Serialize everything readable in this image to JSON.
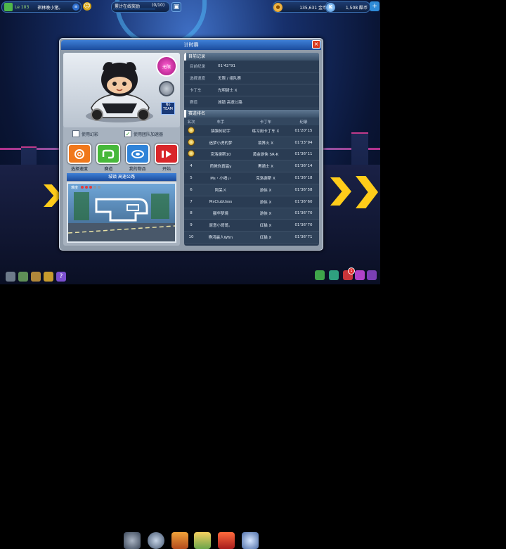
{
  "topbar": {
    "level": "Le 103",
    "player_name": "祺林晚小猪。",
    "online_label": "累计在线奖励",
    "online_progress": "(0/10)",
    "online_fraction": 0,
    "gold": "135,631 金币",
    "kcoin": "1,508 酷币"
  },
  "dialog": {
    "title": "计时赛",
    "close": "×"
  },
  "character": {
    "mode_badge": "无限",
    "team_badge": "No TEAM"
  },
  "options": {
    "checkbox1_label": "使用幻影",
    "checkbox1_checked": false,
    "checkbox2_label": "使用团队加速器",
    "checkbox2_checked": true
  },
  "actions": [
    {
      "label": "选择速度",
      "color": "#f0781c",
      "icon": "gauge-icon"
    },
    {
      "label": "赛道",
      "color": "#47b83a",
      "icon": "track-icon"
    },
    {
      "label": "我的物品",
      "color": "#2f83d8",
      "icon": "item-icon"
    },
    {
      "label": "开始",
      "color": "#d9262a",
      "icon": "play-icon"
    }
  ],
  "track": {
    "title": "城镇 高速公路",
    "map_label": "难度",
    "difficulty_filled": 3,
    "difficulty_total": 5
  },
  "record": {
    "header": "目前记录",
    "rows": [
      {
        "key": "目前纪录",
        "value": "01'42\"91"
      },
      {
        "key": "选择速度",
        "value": "无限 / 组队赛"
      },
      {
        "key": "卡丁车",
        "value": "光明骑士 X"
      },
      {
        "key": "赛道",
        "value": "城镇 高速公路"
      }
    ]
  },
  "ranking": {
    "header": "赛道排名",
    "columns": [
      "名次",
      "车手",
      "卡丁车",
      "纪录"
    ],
    "rows": [
      {
        "rank": "1",
        "medal": true,
        "driver": "猫猫何初宇",
        "kart": "练习用卡丁车 X",
        "time": "01'20\"15"
      },
      {
        "rank": "2",
        "medal": true,
        "driver": "追梦小虎的梦",
        "kart": "境界火 X",
        "time": "01'33\"94"
      },
      {
        "rank": "3",
        "medal": true,
        "driver": "克洛谢斯10",
        "kart": "黄金游侠 SR-K",
        "time": "01'36\"11"
      },
      {
        "rank": "4",
        "medal": false,
        "driver": "药爸你真猛y",
        "kart": "黑骑士 X",
        "time": "01'36\"14"
      },
      {
        "rank": "5",
        "medal": false,
        "driver": "Ms・小魂ぃ",
        "kart": "克洛谢斯 X",
        "time": "01'36\"18"
      },
      {
        "rank": "6",
        "medal": false,
        "driver": "阿呆ㄨ",
        "kart": "游侠 X",
        "time": "01'36\"58"
      },
      {
        "rank": "7",
        "medal": false,
        "driver": "MsClubUsss",
        "kart": "游侠 X",
        "time": "01'36\"60"
      },
      {
        "rank": "8",
        "medal": false,
        "driver": "额华梦境",
        "kart": "游侠 X",
        "time": "01'36\"70"
      },
      {
        "rank": "9",
        "medal": false,
        "driver": "原意小哥哥。",
        "kart": "红猫 X",
        "time": "01'36\"70"
      },
      {
        "rank": "10",
        "medal": false,
        "driver": "狰鸿晨人Wfm",
        "kart": "红猫 X",
        "time": "01'36\"71"
      }
    ]
  },
  "bottom": {
    "notification_count": "1"
  }
}
